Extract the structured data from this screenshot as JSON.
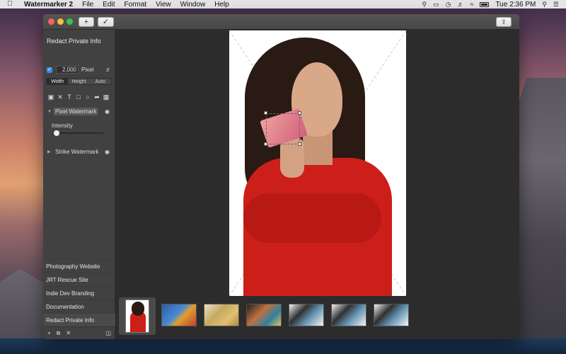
{
  "menubar": {
    "app_name": "Watermarker 2",
    "menus": [
      "File",
      "Edit",
      "Format",
      "View",
      "Window",
      "Help"
    ],
    "clock": "Tue 2:36 PM"
  },
  "sidebar": {
    "title": "Redact Private Info",
    "size_value": "2,000",
    "size_unit": "Pixel",
    "size_enabled": true,
    "dimension_tabs": [
      "Width",
      "Height",
      "Auto"
    ],
    "selected_dimension": "Width",
    "tools": [
      "image-icon",
      "cross-icon",
      "text-icon",
      "rectangle-icon",
      "circle-icon",
      "arrow-icon",
      "checker-icon"
    ],
    "watermarks": [
      {
        "label": "Pixel Watermark",
        "expanded": true,
        "selected": true
      },
      {
        "label": "Strike Watermark",
        "expanded": false,
        "selected": false
      }
    ],
    "intensity_label": "Intensity",
    "intensity_value": 0.1,
    "presets": [
      "Photography Website",
      "JRT Rescue Site",
      "Indie Dev Branding",
      "Documentation",
      "Redact Private Info"
    ],
    "selected_preset": "Redact Private Info"
  },
  "filmstrip": {
    "thumbnails": [
      "woman-red-sweater",
      "visa-cards",
      "gold-card",
      "credit-cards-stack",
      "card-1",
      "card-2",
      "card-3"
    ],
    "selected_index": 0
  },
  "colors": {
    "accent": "#3b8bea",
    "sweater": "#cc1f1a"
  }
}
